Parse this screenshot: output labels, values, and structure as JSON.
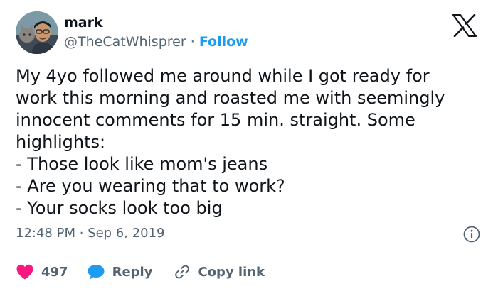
{
  "author": {
    "name": "mark",
    "handle": "@TheCatWhisprer",
    "separator": "·",
    "follow_label": "Follow"
  },
  "tweet": {
    "lines": [
      "My 4yo followed me around while I got ready for",
      "work this morning and roasted me with seemingly",
      "innocent comments for 15 min. straight. Some",
      "highlights:",
      "- Those look like mom's jeans",
      "- Are you wearing that to work?",
      "- Your socks look too big"
    ],
    "timestamp": "12:48 PM · Sep 6, 2019"
  },
  "actions": {
    "like_count": "497",
    "reply_label": "Reply",
    "copy_label": "Copy link"
  },
  "icons": {
    "logo": "x-logo-icon",
    "info": "info-icon",
    "like": "heart-icon",
    "reply": "speech-bubble-icon",
    "copy": "link-icon"
  },
  "colors": {
    "text": "#0f1419",
    "muted": "#536471",
    "accent": "#1d9bf0",
    "like": "#f91880",
    "divider": "#cfd9de"
  }
}
